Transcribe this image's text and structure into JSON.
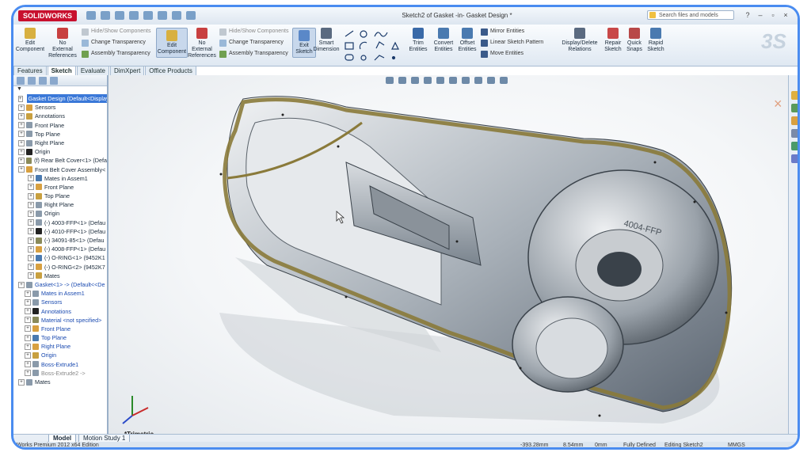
{
  "app": {
    "logo_text": "SOLIDWORKS",
    "window_title": "Sketch2 of Gasket -in- Gasket Design *",
    "search_placeholder": "Search files and models"
  },
  "ribbon": {
    "edit_component_1": "Edit\nComponent",
    "no_external_refs_1": "No\nExternal\nReferences",
    "hide_show_1": "Hide/Show Components",
    "change_transparency_1": "Change Transparency",
    "assembly_transparency_1": "Assembly Transparency",
    "edit_component_2": "Edit\nComponent",
    "no_external_refs_2": "No\nExternal\nReferences",
    "hide_show_2": "Hide/Show Components",
    "change_transparency_2": "Change Transparency",
    "assembly_transparency_2": "Assembly Transparency",
    "exit_sketch": "Exit\nSketch",
    "smart_dimension": "Smart\nDimension",
    "trim_entities": "Trim\nEntities",
    "convert_entities": "Convert\nEntities",
    "offset_entities": "Offset\nEntities",
    "mirror_entities": "Mirror Entities",
    "linear_sketch_pattern": "Linear Sketch Pattern",
    "move_entities": "Move Entities",
    "display_delete_relations": "Display/Delete\nRelations",
    "repair_sketch": "Repair\nSketch",
    "quick_snaps": "Quick\nSnaps",
    "rapid_sketch": "Rapid\nSketch"
  },
  "tabs": [
    {
      "label": "Features"
    },
    {
      "label": "Sketch"
    },
    {
      "label": "Evaluate"
    },
    {
      "label": "DimXpert"
    },
    {
      "label": "Office Products"
    }
  ],
  "feature_tree": {
    "filter_label": "",
    "items": [
      {
        "label": "Gasket Design  (Default<Display",
        "selected": true
      },
      {
        "label": "Sensors"
      },
      {
        "label": "Annotations"
      },
      {
        "label": "Front Plane"
      },
      {
        "label": "Top Plane"
      },
      {
        "label": "Right Plane"
      },
      {
        "label": "Origin"
      },
      {
        "label": "(f) Rear Belt Cover<1> (Defa"
      },
      {
        "label": "Front Belt Cover Assembly<"
      },
      {
        "label": "Mates in Assem1"
      },
      {
        "label": "Front Plane"
      },
      {
        "label": "Top Plane"
      },
      {
        "label": "Right Plane"
      },
      {
        "label": "Origin"
      },
      {
        "label": "(-) 4003-FFP<1> (Defau"
      },
      {
        "label": "(-) 4010-FFP<1> (Defau"
      },
      {
        "label": "(-) 34091-85<1> (Defau"
      },
      {
        "label": "(-) 4008-FFP<1> (Defau"
      },
      {
        "label": "(-) O-RING<1> (9452K1"
      },
      {
        "label": "(-) O-RING<2> (9452K7"
      },
      {
        "label": "Mates"
      },
      {
        "label": "Gasket<1> -> (Default<<De",
        "blue": true
      },
      {
        "label": "Mates in Assem1",
        "blue": true
      },
      {
        "label": "Sensors",
        "blue": true
      },
      {
        "label": "Annotations",
        "blue": true
      },
      {
        "label": "Material <not specified>",
        "blue": true
      },
      {
        "label": "Front Plane",
        "blue": true
      },
      {
        "label": "Top Plane",
        "blue": true
      },
      {
        "label": "Right Plane",
        "blue": true
      },
      {
        "label": "Origin",
        "blue": true
      },
      {
        "label": "Boss-Extrude1",
        "blue": true
      },
      {
        "label": "Boss-Extrude2 ->",
        "grey": true
      },
      {
        "label": "Mates"
      }
    ]
  },
  "bottom_tabs": {
    "model": "Model",
    "motion_study": "Motion Study 1"
  },
  "viewport": {
    "view_label": "*Trimetric",
    "part_engraving": "4004-FFP"
  },
  "status": {
    "edition": "Works Premium 2012 x64 Edition",
    "coord_x": "-393.28mm",
    "coord_y": "8.54mm",
    "coord_z": "0mm",
    "state": "Fully Defined",
    "editing": "Editing Sketch2",
    "units": "MMGS"
  },
  "colors": {
    "accent": "#4a8cf0",
    "gasket": "#8a7a3a",
    "metal": "#b8bec6"
  }
}
